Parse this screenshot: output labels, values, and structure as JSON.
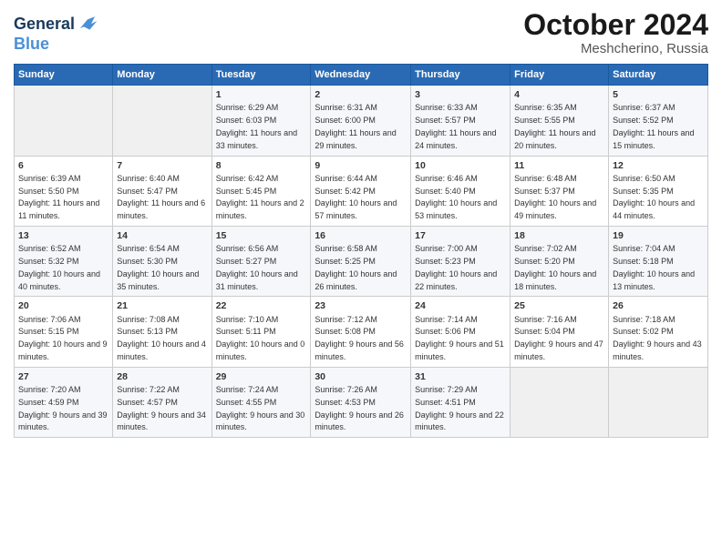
{
  "header": {
    "logo_line1": "General",
    "logo_line2": "Blue",
    "month": "October 2024",
    "location": "Meshcherino, Russia"
  },
  "weekdays": [
    "Sunday",
    "Monday",
    "Tuesday",
    "Wednesday",
    "Thursday",
    "Friday",
    "Saturday"
  ],
  "weeks": [
    [
      {
        "day": "",
        "detail": ""
      },
      {
        "day": "",
        "detail": ""
      },
      {
        "day": "1",
        "detail": "Sunrise: 6:29 AM\nSunset: 6:03 PM\nDaylight: 11 hours and 33 minutes."
      },
      {
        "day": "2",
        "detail": "Sunrise: 6:31 AM\nSunset: 6:00 PM\nDaylight: 11 hours and 29 minutes."
      },
      {
        "day": "3",
        "detail": "Sunrise: 6:33 AM\nSunset: 5:57 PM\nDaylight: 11 hours and 24 minutes."
      },
      {
        "day": "4",
        "detail": "Sunrise: 6:35 AM\nSunset: 5:55 PM\nDaylight: 11 hours and 20 minutes."
      },
      {
        "day": "5",
        "detail": "Sunrise: 6:37 AM\nSunset: 5:52 PM\nDaylight: 11 hours and 15 minutes."
      }
    ],
    [
      {
        "day": "6",
        "detail": "Sunrise: 6:39 AM\nSunset: 5:50 PM\nDaylight: 11 hours and 11 minutes."
      },
      {
        "day": "7",
        "detail": "Sunrise: 6:40 AM\nSunset: 5:47 PM\nDaylight: 11 hours and 6 minutes."
      },
      {
        "day": "8",
        "detail": "Sunrise: 6:42 AM\nSunset: 5:45 PM\nDaylight: 11 hours and 2 minutes."
      },
      {
        "day": "9",
        "detail": "Sunrise: 6:44 AM\nSunset: 5:42 PM\nDaylight: 10 hours and 57 minutes."
      },
      {
        "day": "10",
        "detail": "Sunrise: 6:46 AM\nSunset: 5:40 PM\nDaylight: 10 hours and 53 minutes."
      },
      {
        "day": "11",
        "detail": "Sunrise: 6:48 AM\nSunset: 5:37 PM\nDaylight: 10 hours and 49 minutes."
      },
      {
        "day": "12",
        "detail": "Sunrise: 6:50 AM\nSunset: 5:35 PM\nDaylight: 10 hours and 44 minutes."
      }
    ],
    [
      {
        "day": "13",
        "detail": "Sunrise: 6:52 AM\nSunset: 5:32 PM\nDaylight: 10 hours and 40 minutes."
      },
      {
        "day": "14",
        "detail": "Sunrise: 6:54 AM\nSunset: 5:30 PM\nDaylight: 10 hours and 35 minutes."
      },
      {
        "day": "15",
        "detail": "Sunrise: 6:56 AM\nSunset: 5:27 PM\nDaylight: 10 hours and 31 minutes."
      },
      {
        "day": "16",
        "detail": "Sunrise: 6:58 AM\nSunset: 5:25 PM\nDaylight: 10 hours and 26 minutes."
      },
      {
        "day": "17",
        "detail": "Sunrise: 7:00 AM\nSunset: 5:23 PM\nDaylight: 10 hours and 22 minutes."
      },
      {
        "day": "18",
        "detail": "Sunrise: 7:02 AM\nSunset: 5:20 PM\nDaylight: 10 hours and 18 minutes."
      },
      {
        "day": "19",
        "detail": "Sunrise: 7:04 AM\nSunset: 5:18 PM\nDaylight: 10 hours and 13 minutes."
      }
    ],
    [
      {
        "day": "20",
        "detail": "Sunrise: 7:06 AM\nSunset: 5:15 PM\nDaylight: 10 hours and 9 minutes."
      },
      {
        "day": "21",
        "detail": "Sunrise: 7:08 AM\nSunset: 5:13 PM\nDaylight: 10 hours and 4 minutes."
      },
      {
        "day": "22",
        "detail": "Sunrise: 7:10 AM\nSunset: 5:11 PM\nDaylight: 10 hours and 0 minutes."
      },
      {
        "day": "23",
        "detail": "Sunrise: 7:12 AM\nSunset: 5:08 PM\nDaylight: 9 hours and 56 minutes."
      },
      {
        "day": "24",
        "detail": "Sunrise: 7:14 AM\nSunset: 5:06 PM\nDaylight: 9 hours and 51 minutes."
      },
      {
        "day": "25",
        "detail": "Sunrise: 7:16 AM\nSunset: 5:04 PM\nDaylight: 9 hours and 47 minutes."
      },
      {
        "day": "26",
        "detail": "Sunrise: 7:18 AM\nSunset: 5:02 PM\nDaylight: 9 hours and 43 minutes."
      }
    ],
    [
      {
        "day": "27",
        "detail": "Sunrise: 7:20 AM\nSunset: 4:59 PM\nDaylight: 9 hours and 39 minutes."
      },
      {
        "day": "28",
        "detail": "Sunrise: 7:22 AM\nSunset: 4:57 PM\nDaylight: 9 hours and 34 minutes."
      },
      {
        "day": "29",
        "detail": "Sunrise: 7:24 AM\nSunset: 4:55 PM\nDaylight: 9 hours and 30 minutes."
      },
      {
        "day": "30",
        "detail": "Sunrise: 7:26 AM\nSunset: 4:53 PM\nDaylight: 9 hours and 26 minutes."
      },
      {
        "day": "31",
        "detail": "Sunrise: 7:29 AM\nSunset: 4:51 PM\nDaylight: 9 hours and 22 minutes."
      },
      {
        "day": "",
        "detail": ""
      },
      {
        "day": "",
        "detail": ""
      }
    ]
  ]
}
